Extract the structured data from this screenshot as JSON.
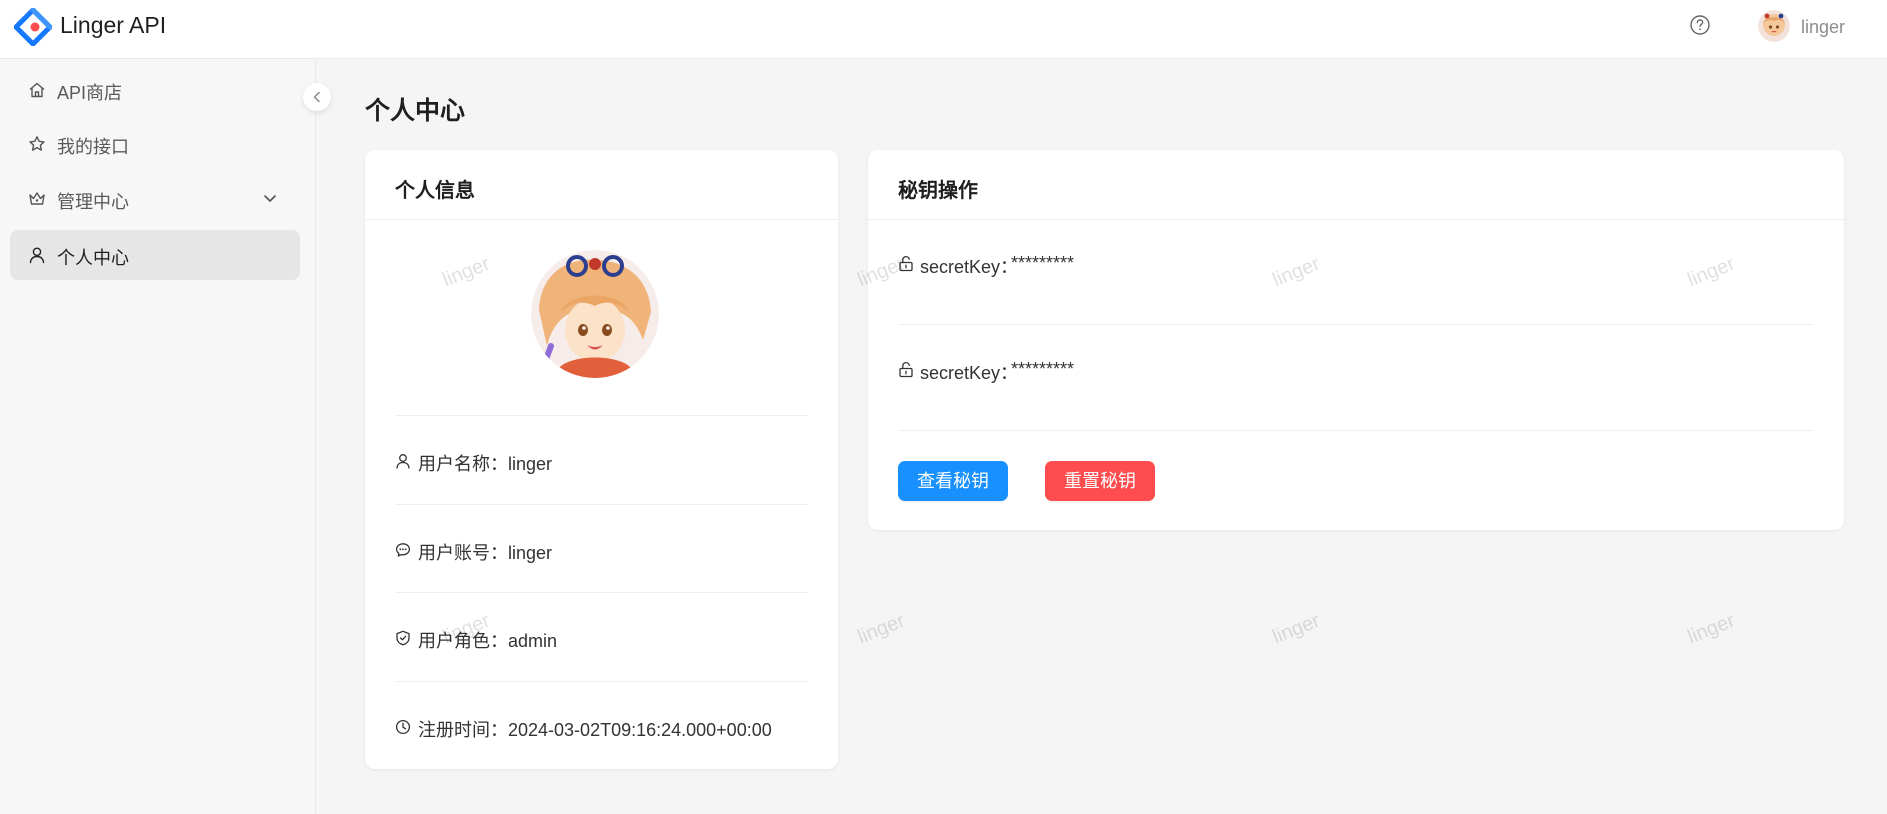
{
  "header": {
    "brand": "Linger API",
    "user_name": "linger"
  },
  "sidebar": {
    "items": [
      {
        "label": "API商店",
        "icon": "home-icon"
      },
      {
        "label": "我的接口",
        "icon": "star-icon"
      },
      {
        "label": "管理中心",
        "icon": "crown-icon"
      },
      {
        "label": "个人中心",
        "icon": "user-icon",
        "active": true
      }
    ]
  },
  "main": {
    "page_title": "个人中心"
  },
  "profile_card": {
    "title": "个人信息",
    "rows": [
      {
        "label": "用户名称：",
        "value": "linger"
      },
      {
        "label": "用户账号：",
        "value": "linger"
      },
      {
        "label": "用户角色：",
        "value": "admin"
      },
      {
        "label": "注册时间：",
        "value": "2024-03-02T09:16:24.000+00:00"
      }
    ]
  },
  "key_card": {
    "title": "秘钥操作",
    "rows": [
      {
        "label": "secretKey：",
        "value": "*********"
      },
      {
        "label": "secretKey：",
        "value": "*********"
      }
    ],
    "view_button": "查看秘钥",
    "reset_button": "重置秘钥"
  },
  "watermark": "linger",
  "colors": {
    "primary": "#1890ff",
    "danger": "#ff4d4f",
    "logo_blue": "#1677ff",
    "logo_red": "#ff4d4f"
  }
}
